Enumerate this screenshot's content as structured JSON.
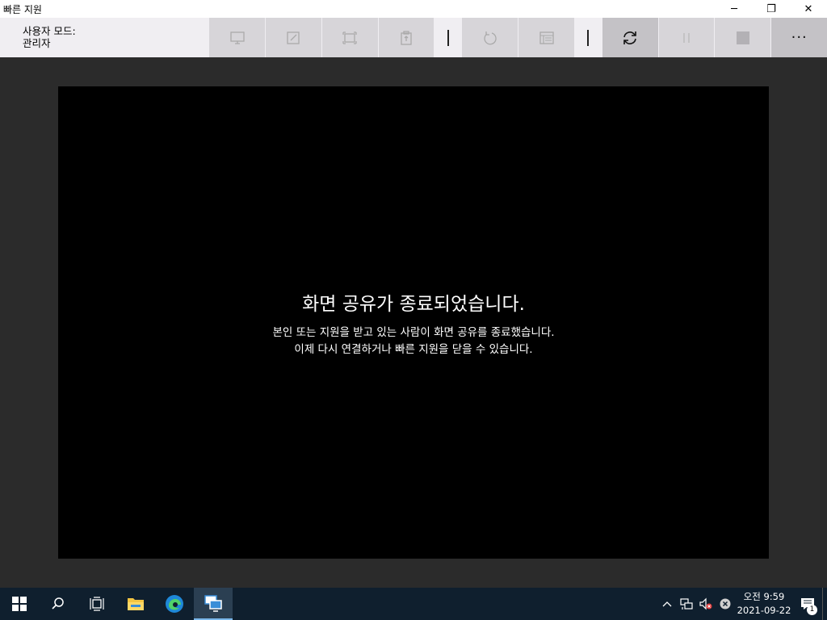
{
  "window": {
    "title": "빠른 지원",
    "minimize_glyph": "─",
    "restore_glyph": "❐",
    "close_glyph": "✕"
  },
  "toolbar": {
    "mode_label": "사용자 모드:",
    "mode_value": "관리자",
    "buttons": [
      {
        "icon": "monitor-icon",
        "enabled": false
      },
      {
        "icon": "annotate-icon",
        "enabled": false
      },
      {
        "icon": "fit-screen-icon",
        "enabled": false
      },
      {
        "icon": "clipboard-icon",
        "enabled": false
      },
      {
        "icon": "restart-icon",
        "enabled": false
      },
      {
        "icon": "task-manager-icon",
        "enabled": false
      },
      {
        "icon": "reconnect-icon",
        "enabled": true
      },
      {
        "icon": "pause-icon",
        "enabled": false
      },
      {
        "icon": "stop-icon",
        "enabled": false
      },
      {
        "icon": "more-icon",
        "enabled": true,
        "glyph": "···"
      }
    ]
  },
  "session": {
    "heading": "화면 공유가 종료되었습니다.",
    "line1": "본인 또는 지원을 받고 있는 사람이 화면 공유를 종료했습니다.",
    "line2": "이제 다시 연결하거나 빠른 지원을 닫을 수 있습니다."
  },
  "taskbar": {
    "items": [
      "windows-start-icon",
      "search-icon",
      "task-view-icon",
      "file-explorer-icon",
      "edge-icon",
      "quick-assist-icon"
    ],
    "tray": [
      "chevron-up-icon",
      "network-icon",
      "volume-muted-icon",
      "error-icon"
    ],
    "clock_time": "오전 9:59",
    "clock_date": "2021-09-22",
    "notification_count": "1"
  },
  "colors": {
    "toolbar_bg": "#f0eef2",
    "button_bg": "#d7d5d9",
    "session_bg": "#000000",
    "workspace_bg": "#2b2b2b",
    "taskbar_bg": "#0f1f2e"
  }
}
